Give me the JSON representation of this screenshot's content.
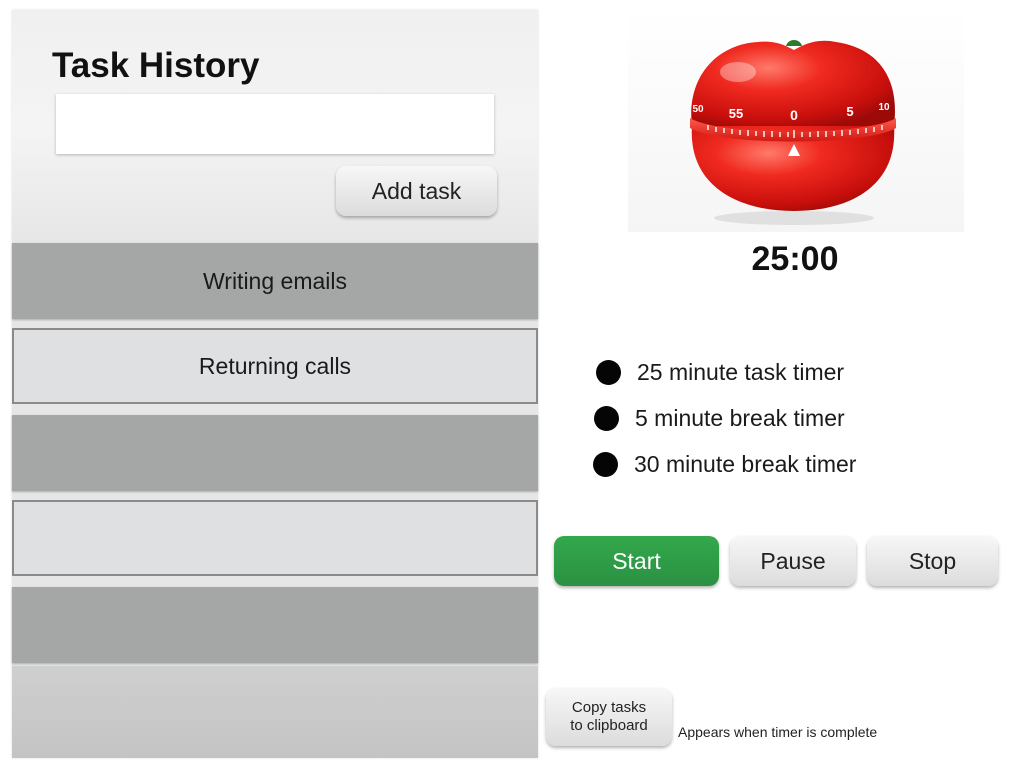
{
  "task_panel": {
    "title": "Task History",
    "input_value": "",
    "input_placeholder": "",
    "add_button_label": "Add task",
    "tasks": [
      {
        "label": "Writing emails"
      },
      {
        "label": "Returning calls"
      },
      {
        "label": ""
      },
      {
        "label": ""
      },
      {
        "label": ""
      }
    ]
  },
  "timer": {
    "image_icon": "tomato-kitchen-timer-icon",
    "dial_numbers": [
      "50",
      "55",
      "0",
      "5",
      "10"
    ],
    "display": "25:00",
    "options": [
      {
        "label": "25 minute task timer"
      },
      {
        "label": "5 minute break timer"
      },
      {
        "label": "30 minute break timer"
      }
    ],
    "controls": {
      "start_label": "Start",
      "pause_label": "Pause",
      "stop_label": "Stop"
    },
    "copy_button": {
      "line1": "Copy tasks",
      "line2": "to clipboard"
    },
    "copy_note": "Appears when timer is complete"
  },
  "colors": {
    "start_green": "#2e9c47",
    "tomato_red": "#e8201c",
    "row_dark": "#a5a7a6",
    "row_light": "#dfe0e2"
  }
}
